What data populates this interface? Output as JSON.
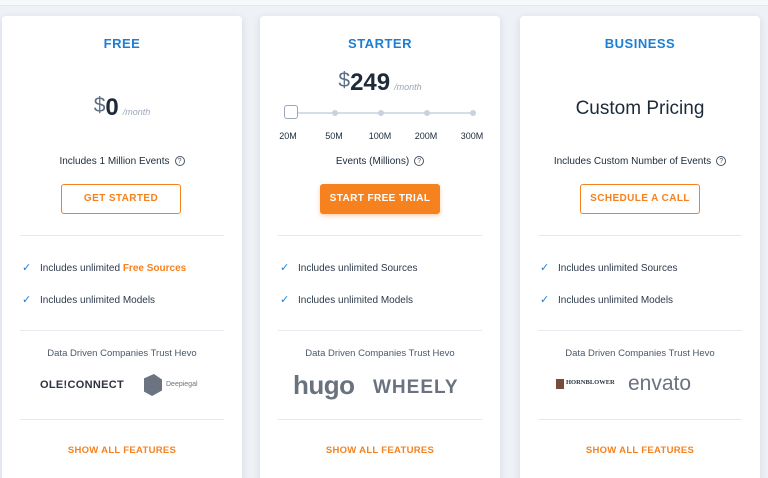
{
  "plans": {
    "free": {
      "title": "FREE",
      "currency": "$",
      "price": "0",
      "period": "/month",
      "events": "Includes 1 Million Events",
      "button": "GET STARTED",
      "features": [
        {
          "prefix": "Includes unlimited ",
          "highlight": "Free Sources"
        },
        {
          "prefix": "Includes unlimited Models",
          "highlight": ""
        }
      ],
      "trust": "Data Driven Companies Trust Hevo",
      "logos": [
        "OLE!CONNECT",
        "Deepiegal"
      ],
      "show_all": "SHOW ALL FEATURES"
    },
    "starter": {
      "title": "STARTER",
      "currency": "$",
      "price": "249",
      "period": "/month",
      "slider_ticks": [
        "20M",
        "50M",
        "100M",
        "200M",
        "300M"
      ],
      "slider_value": "20M",
      "events": "Events (Millions)",
      "button": "START FREE TRIAL",
      "features": [
        {
          "prefix": "Includes unlimited Sources",
          "highlight": ""
        },
        {
          "prefix": "Includes unlimited Models",
          "highlight": ""
        }
      ],
      "trust": "Data Driven Companies Trust Hevo",
      "logos": [
        "hugo",
        "WHEELY"
      ],
      "show_all": "SHOW ALL FEATURES"
    },
    "business": {
      "title": "BUSINESS",
      "price_text": "Custom Pricing",
      "events": "Includes Custom Number of Events",
      "button": "SCHEDULE A CALL",
      "features": [
        {
          "prefix": "Includes unlimited Sources",
          "highlight": ""
        },
        {
          "prefix": "Includes unlimited Models",
          "highlight": ""
        }
      ],
      "trust": "Data Driven Companies Trust Hevo",
      "logos": [
        "HORNBLOWER",
        "envato"
      ],
      "show_all": "SHOW ALL FEATURES"
    }
  },
  "icons": {
    "check": "check-icon",
    "info": "info-icon"
  },
  "colors": {
    "accent": "#f5821f",
    "title": "#1b7fd6"
  }
}
